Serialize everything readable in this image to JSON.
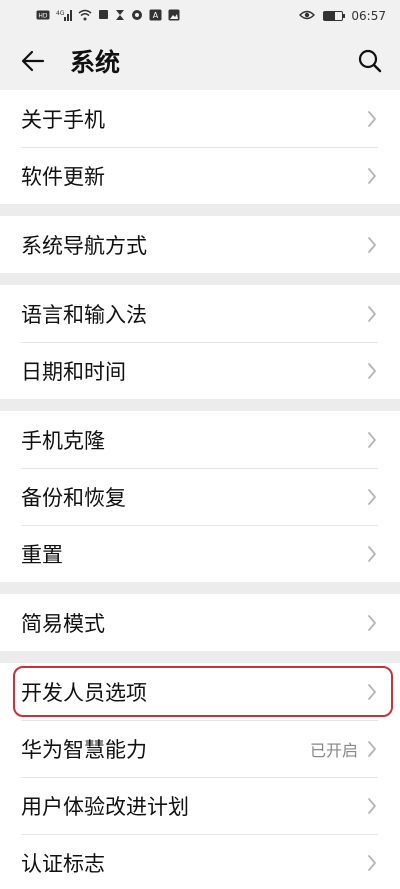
{
  "status_bar": {
    "left_icons": [
      "hd-icon",
      "signal-4g-icon",
      "wifi-icon",
      "square-icon",
      "hourglass-icon",
      "settings-icon",
      "translate-icon",
      "gallery-icon"
    ],
    "time": "06:57",
    "battery_level": 0.6
  },
  "header": {
    "title": "系统"
  },
  "groups": [
    {
      "items": [
        {
          "label": "关于手机"
        },
        {
          "label": "软件更新"
        }
      ]
    },
    {
      "items": [
        {
          "label": "系统导航方式"
        }
      ]
    },
    {
      "items": [
        {
          "label": "语言和输入法"
        },
        {
          "label": "日期和时间"
        }
      ]
    },
    {
      "items": [
        {
          "label": "手机克隆"
        },
        {
          "label": "备份和恢复"
        },
        {
          "label": "重置"
        }
      ]
    },
    {
      "items": [
        {
          "label": "简易模式"
        }
      ]
    },
    {
      "items": [
        {
          "label": "开发人员选项",
          "highlighted": true
        },
        {
          "label": "华为智慧能力",
          "value": "已开启"
        },
        {
          "label": "用户体验改进计划"
        },
        {
          "label": "认证标志"
        }
      ]
    }
  ],
  "colors": {
    "highlight": "#c8323c",
    "background": "#f1f1f1",
    "card": "#ffffff"
  }
}
